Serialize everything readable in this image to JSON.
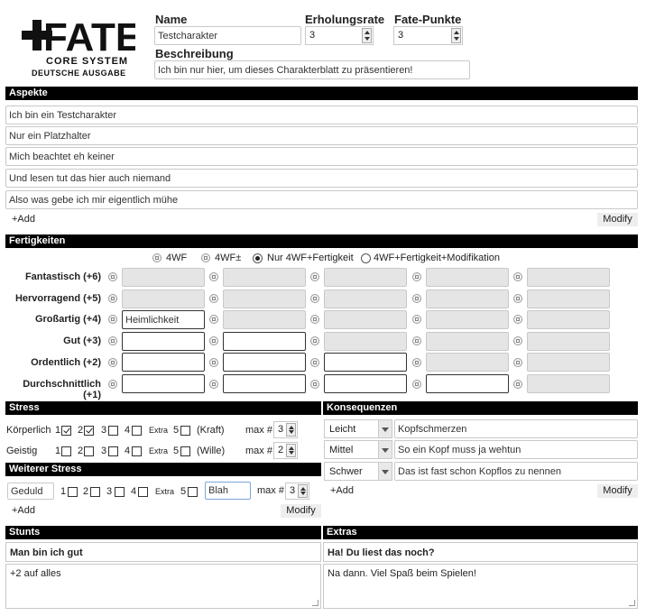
{
  "logo": {
    "main": "FATE",
    "line1": "CORE SYSTEM",
    "line2": "DEUTSCHE AUSGABE"
  },
  "header": {
    "name_label": "Name",
    "name_value": "Testcharakter",
    "refresh_label": "Erholungsrate",
    "refresh_value": "3",
    "fate_label": "Fate-Punkte",
    "fate_value": "3",
    "desc_label": "Beschreibung",
    "desc_value": "Ich bin nur hier, um dieses Charakterblatt zu präsentieren!"
  },
  "aspects": {
    "title": "Aspekte",
    "items": [
      "Ich bin ein Testcharakter",
      "Nur ein Platzhalter",
      "Mich beachtet eh keiner",
      "Und lesen tut das hier auch niemand",
      "Also was gebe ich mir eigentlich mühe"
    ],
    "add_label": "+Add",
    "modify_label": "Modify"
  },
  "skills": {
    "title": "Fertigkeiten",
    "options": [
      "4WF",
      "4WF±",
      "Nur 4WF+Fertigkeit",
      "4WF+Fertigkeit+Modifikation"
    ],
    "selected_option": "Nur 4WF+Fertigkeit",
    "levels": [
      "Fantastisch (+6)",
      "Hervorragend (+5)",
      "Großartig (+4)",
      "Gut (+3)",
      "Ordentlich (+2)",
      "Durchschnittlich (+1)"
    ],
    "values": {
      "great_1": "Heimlichkeit"
    }
  },
  "stress": {
    "title": "Stress",
    "rows": [
      {
        "label": "Körperlich",
        "tag": "(Kraft)",
        "max_label": "max #",
        "max": "3"
      },
      {
        "label": "Geistig",
        "tag": "(Wille)",
        "max_label": "max #",
        "max": "2"
      }
    ],
    "box_nums": [
      "1",
      "2",
      "3",
      "4",
      "Extra",
      "5"
    ],
    "more_title": "Weiterer Stress",
    "custom_name": "Geduld",
    "custom_tag": "Blah",
    "custom_max_label": "max #",
    "custom_max": "3",
    "add_label": "+Add",
    "modify_label": "Modify"
  },
  "consequences": {
    "title": "Konsequenzen",
    "items": [
      {
        "severity": "Leicht",
        "text": "Kopfschmerzen"
      },
      {
        "severity": "Mittel",
        "text": "So ein Kopf muss ja wehtun"
      },
      {
        "severity": "Schwer",
        "text": "Das ist fast schon Kopflos zu nennen"
      }
    ],
    "add_label": "+Add",
    "modify_label": "Modify"
  },
  "stunts": {
    "title": "Stunts",
    "name": "Man bin ich gut",
    "text": "+2 auf alles"
  },
  "extras": {
    "title": "Extras",
    "name": "Ha! Du liest das noch?",
    "text": "Na dann. Viel Spaß beim Spielen!"
  }
}
